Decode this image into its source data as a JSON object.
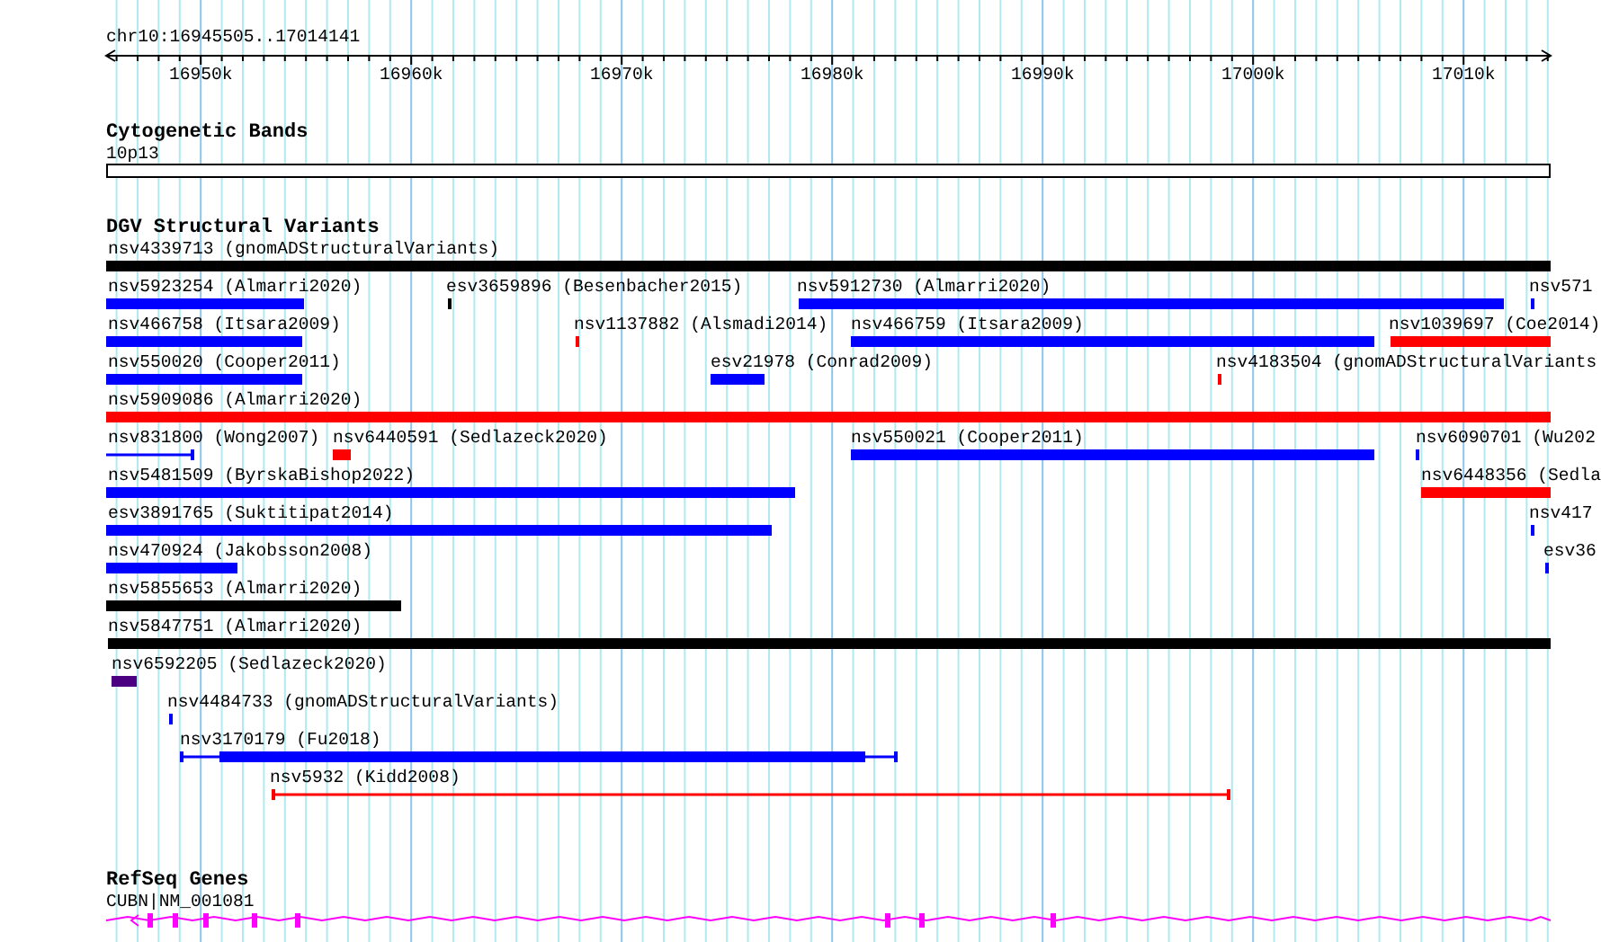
{
  "location": "chr10:16945505..17014141",
  "ruler": {
    "labels": [
      "16950k",
      "16960k",
      "16970k",
      "16980k",
      "16990k",
      "17000k",
      "17010k"
    ]
  },
  "tracks": [
    {
      "kind": "bands",
      "title": "Cytogenetic Bands",
      "bands": [
        {
          "label": "10p13"
        }
      ]
    },
    {
      "kind": "variants",
      "title": "DGV Structural Variants",
      "rows": [
        {
          "features": [
            {
              "label": "nsv4339713 (gnomADStructuralVariants)",
              "color": "#000000",
              "kind": "bar"
            }
          ]
        },
        {
          "features": [
            {
              "label": "nsv5923254 (Almarri2020)",
              "color": "#0000ff",
              "kind": "bar"
            },
            {
              "label": "esv3659896 (Besenbacher2015)",
              "color": "#000000",
              "kind": "bar"
            },
            {
              "label": "nsv5912730 (Almarri2020)",
              "color": "#0000ff",
              "kind": "bar"
            },
            {
              "label": "nsv571",
              "color": "#0000ff",
              "kind": "bar"
            }
          ]
        },
        {
          "features": [
            {
              "label": "nsv466758 (Itsara2009)",
              "color": "#0000ff",
              "kind": "bar"
            },
            {
              "label": "nsv1137882 (Alsmadi2014)",
              "color": "#ff0000",
              "kind": "bar"
            },
            {
              "label": "nsv466759 (Itsara2009)",
              "color": "#0000ff",
              "kind": "bar"
            },
            {
              "label": "nsv1039697 (Coe2014)",
              "color": "#ff0000",
              "kind": "bar"
            }
          ]
        },
        {
          "features": [
            {
              "label": "nsv550020 (Cooper2011)",
              "color": "#0000ff",
              "kind": "bar"
            },
            {
              "label": "esv21978 (Conrad2009)",
              "color": "#0000ff",
              "kind": "bar"
            },
            {
              "label": "nsv4183504 (gnomADStructuralVariants",
              "color": "#ff0000",
              "kind": "bar"
            }
          ]
        },
        {
          "features": [
            {
              "label": "nsv5909086 (Almarri2020)",
              "color": "#ff0000",
              "kind": "bar"
            }
          ]
        },
        {
          "features": [
            {
              "label": "nsv831800 (Wong2007)",
              "color": "#0000ff",
              "kind": "line"
            },
            {
              "label": "nsv6440591 (Sedlazeck2020)",
              "color": "#ff0000",
              "kind": "bar"
            },
            {
              "label": "nsv550021 (Cooper2011)",
              "color": "#0000ff",
              "kind": "bar"
            },
            {
              "label": "nsv6090701 (Wu202",
              "color": "#0000ff",
              "kind": "bar"
            }
          ]
        },
        {
          "features": [
            {
              "label": "nsv5481509 (ByrskaBishop2022)",
              "color": "#0000ff",
              "kind": "bar"
            },
            {
              "label": "nsv6448356 (Sedla",
              "color": "#ff0000",
              "kind": "bar"
            }
          ]
        },
        {
          "features": [
            {
              "label": "esv3891765 (Suktitipat2014)",
              "color": "#0000ff",
              "kind": "bar"
            },
            {
              "label": "nsv417",
              "color": "#0000ff",
              "kind": "bar"
            }
          ]
        },
        {
          "features": [
            {
              "label": "nsv470924 (Jakobsson2008)",
              "color": "#0000ff",
              "kind": "bar"
            },
            {
              "label": "esv36",
              "color": "#0000ff",
              "kind": "bar"
            }
          ]
        },
        {
          "features": [
            {
              "label": "nsv5855653 (Almarri2020)",
              "color": "#000000",
              "kind": "bar"
            }
          ]
        },
        {
          "features": [
            {
              "label": "nsv5847751 (Almarri2020)",
              "color": "#000000",
              "kind": "bar"
            }
          ]
        },
        {
          "features": [
            {
              "label": "nsv6592205 (Sedlazeck2020)",
              "color": "#4b0082",
              "kind": "bar"
            }
          ]
        },
        {
          "features": [
            {
              "label": "nsv4484733 (gnomADStructuralVariants)",
              "color": "#0000ff",
              "kind": "bar"
            }
          ]
        },
        {
          "features": [
            {
              "label": "nsv3170179 (Fu2018)",
              "color": "#0000ff",
              "kind": "mixed"
            }
          ]
        },
        {
          "features": [
            {
              "label": "nsv5932 (Kidd2008)",
              "color": "#ff0000",
              "kind": "line"
            }
          ]
        }
      ]
    },
    {
      "kind": "genes",
      "title": "RefSeq Genes",
      "genes": [
        {
          "label": "CUBN|NM_001081"
        }
      ]
    }
  ]
}
